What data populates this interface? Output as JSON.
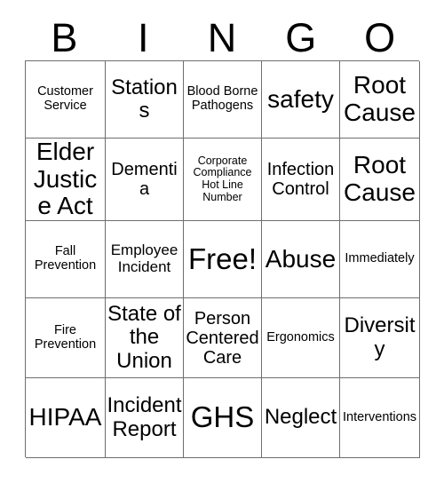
{
  "card": {
    "header_letters": [
      "B",
      "I",
      "N",
      "G",
      "O"
    ],
    "grid": {
      "rows": 5,
      "columns": 5,
      "border_color": "#6e6e6e",
      "background_color": "#ffffff",
      "text_color": "#000000",
      "cells": [
        [
          {
            "label": "Customer Service",
            "size": "sm"
          },
          {
            "label": "Stations",
            "size": "xl"
          },
          {
            "label": "Blood Borne Pathogens",
            "size": "sm"
          },
          {
            "label": "safety",
            "size": "2xl"
          },
          {
            "label": "Root Cause",
            "size": "2xl"
          }
        ],
        [
          {
            "label": "Elder Justice Act",
            "size": "2xl"
          },
          {
            "label": "Dementia",
            "size": "lg"
          },
          {
            "label": "Corporate Compliance Hot Line Number",
            "size": "xs"
          },
          {
            "label": "Infection Control",
            "size": "lg"
          },
          {
            "label": "Root Cause",
            "size": "2xl"
          }
        ],
        [
          {
            "label": "Fall Prevention",
            "size": "sm"
          },
          {
            "label": "Employee Incident",
            "size": "md"
          },
          {
            "label": "Free!",
            "size": "3xl"
          },
          {
            "label": "Abuse",
            "size": "2xl"
          },
          {
            "label": "Immediately",
            "size": "sm"
          }
        ],
        [
          {
            "label": "Fire Prevention",
            "size": "sm"
          },
          {
            "label": "State of the Union",
            "size": "xl"
          },
          {
            "label": "Person Centered Care",
            "size": "lg"
          },
          {
            "label": "Ergonomics",
            "size": "sm"
          },
          {
            "label": "Diversity",
            "size": "xl"
          }
        ],
        [
          {
            "label": "HIPAA",
            "size": "2xl"
          },
          {
            "label": "Incident Report",
            "size": "xl"
          },
          {
            "label": "GHS",
            "size": "3xl"
          },
          {
            "label": "Neglect",
            "size": "xl"
          },
          {
            "label": "Interventions",
            "size": "sm"
          }
        ]
      ]
    }
  }
}
